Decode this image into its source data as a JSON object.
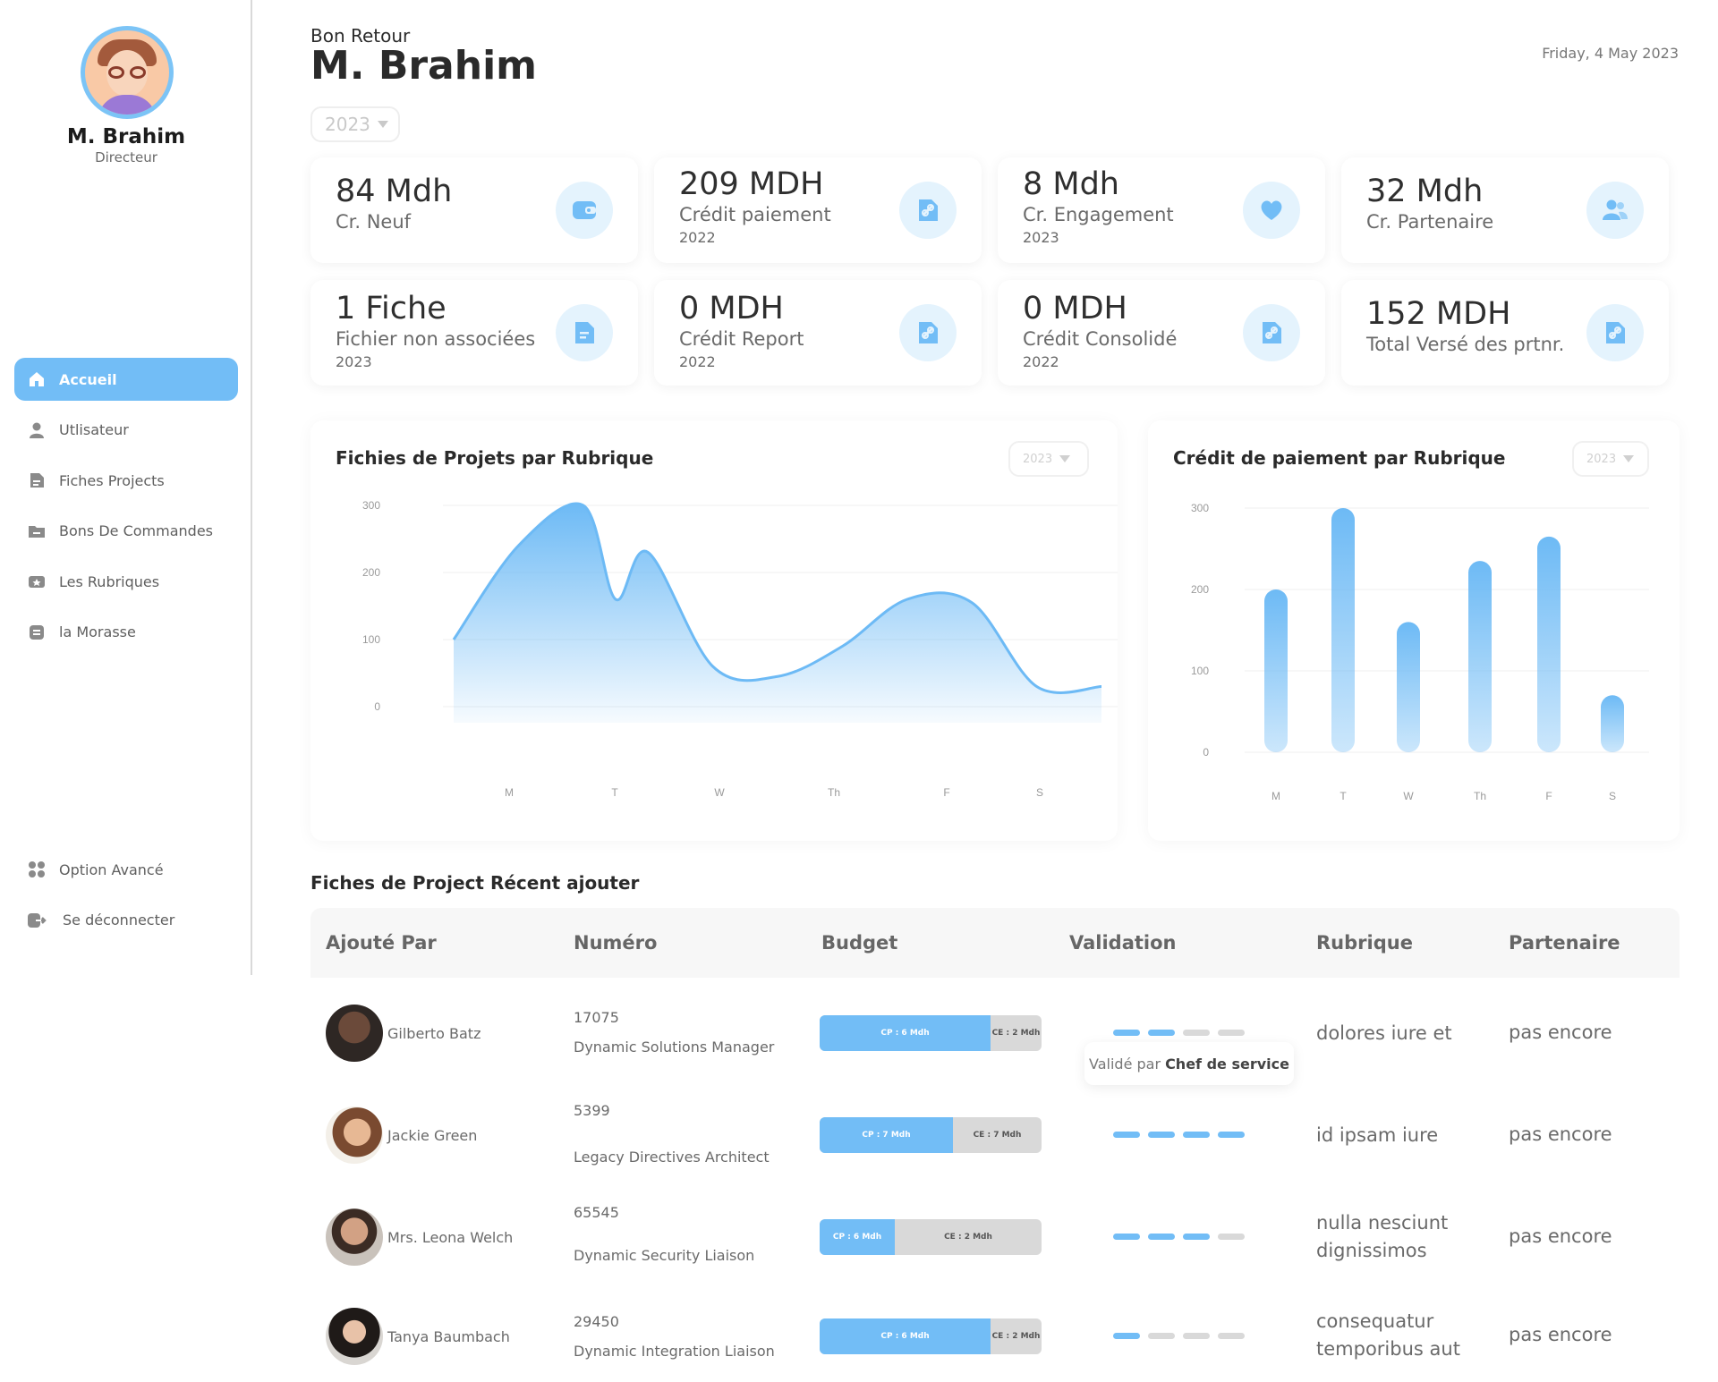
{
  "sidebar": {
    "user_name": "M. Brahim",
    "user_role": "Directeur",
    "items": [
      {
        "label": "Accueil",
        "icon": "home-icon",
        "active": true
      },
      {
        "label": "Utlisateur",
        "icon": "user-icon"
      },
      {
        "label": "Fiches Projects",
        "icon": "document-icon"
      },
      {
        "label": "Bons De Commandes",
        "icon": "folder-icon"
      },
      {
        "label": "Les Rubriques",
        "icon": "ticket-icon"
      },
      {
        "label": "la Morasse",
        "icon": "note-icon"
      }
    ],
    "bottom_items": [
      {
        "label": "Option Avancé",
        "icon": "grid-icon"
      },
      {
        "label": "Se déconnecter",
        "icon": "logout-icon"
      }
    ]
  },
  "header": {
    "greeting": "Bon Retour",
    "title": "M. Brahim",
    "date": "Friday, 4 May 2023",
    "year_select": "2023"
  },
  "cards": [
    {
      "value": "84 Mdh",
      "label": "Cr. Neuf",
      "year": "",
      "icon": "wallet-icon"
    },
    {
      "value": "209 MDH",
      "label": "Crédit paiement",
      "year": "2022",
      "icon": "link-document-icon"
    },
    {
      "value": "8 Mdh",
      "label": "Cr. Engagement",
      "year": "2023",
      "icon": "heart-icon"
    },
    {
      "value": "32 Mdh",
      "label": "Cr. Partenaire",
      "year": "",
      "icon": "users-icon"
    },
    {
      "value": "1 Fiche",
      "label": "Fichier non associées",
      "year": "2023",
      "icon": "file-icon"
    },
    {
      "value": "0 MDH",
      "label": "Crédit Report",
      "year": "2022",
      "icon": "link-document-icon"
    },
    {
      "value": "0 MDH",
      "label": "Crédit Consolidé",
      "year": "2022",
      "icon": "link-document-icon"
    },
    {
      "value": "152 MDH",
      "label": "Total Versé des prtnr.",
      "year": "",
      "icon": "link-document-icon"
    }
  ],
  "colors": {
    "accent": "#72bdf6",
    "accent_light": "#e4f3fd",
    "muted": "#d9d9d9"
  },
  "chart_data": [
    {
      "type": "area",
      "title": "Fichies de Projets par Rubrique",
      "select": "2023",
      "categories": [
        "M",
        "T",
        "W",
        "Th",
        "F",
        "S"
      ],
      "x": [
        0,
        0.5,
        1,
        1.25,
        1.5,
        2,
        2.5,
        3,
        3.5,
        4,
        4.5,
        5
      ],
      "values": [
        100,
        240,
        300,
        160,
        230,
        60,
        45,
        90,
        160,
        155,
        30,
        30
      ],
      "yticks": [
        0,
        100,
        200,
        300
      ],
      "ylim": [
        0,
        300
      ]
    },
    {
      "type": "bar",
      "title": "Crédit de paiement  par Rubrique",
      "select": "2023",
      "categories": [
        "M",
        "T",
        "W",
        "Th",
        "F",
        "S"
      ],
      "values": [
        200,
        300,
        160,
        235,
        265,
        70
      ],
      "yticks": [
        0,
        100,
        200,
        300
      ],
      "ylim": [
        0,
        300
      ]
    }
  ],
  "table": {
    "title": "Fiches de Project Récent ajouter",
    "headers": [
      "Ajouté Par",
      "Numéro",
      "Budget",
      "Validation",
      "Rubrique",
      "Partenaire"
    ],
    "tooltip_prefix": "Validé par",
    "tooltip_strong": "Chef de service",
    "rows": [
      {
        "name": "Gilberto Batz",
        "number": "17075",
        "role": "Dynamic Solutions Manager",
        "cp": "CP : 6 Mdh",
        "ce": "CE : 2 Mdh",
        "cp_fraction": 0.77,
        "validation": 2,
        "rubrique": "dolores iure et",
        "partner": "pas encore"
      },
      {
        "name": "Jackie Green",
        "number": "5399",
        "role": "Legacy Directives Architect",
        "cp": "CP : 7 Mdh",
        "ce": "CE : 7 Mdh",
        "cp_fraction": 0.6,
        "validation": 4,
        "rubrique": "id ipsam iure",
        "partner": "pas encore"
      },
      {
        "name": "Mrs. Leona Welch",
        "number": "65545",
        "role": "Dynamic Security Liaison",
        "cp": "CP : 6 Mdh",
        "ce": "CE : 2 Mdh",
        "cp_fraction": 0.34,
        "validation": 3,
        "rubrique": "nulla nesciunt dignissimos",
        "partner": "pas encore"
      },
      {
        "name": "Tanya Baumbach",
        "number": "29450",
        "role": "Dynamic Integration Liaison",
        "cp": "CP : 6 Mdh",
        "ce": "CE : 2 Mdh",
        "cp_fraction": 0.77,
        "validation": 1,
        "rubrique": "consequatur temporibus aut",
        "partner": "pas encore"
      }
    ]
  }
}
